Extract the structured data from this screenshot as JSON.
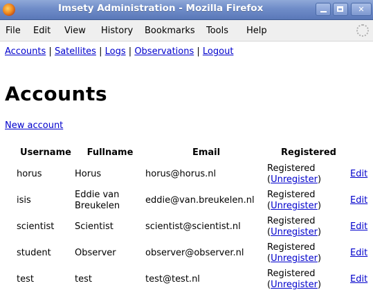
{
  "window": {
    "title": "Imsety Administration - Mozilla Firefox"
  },
  "menubar": {
    "items": [
      "File",
      "Edit",
      "View",
      "History",
      "Bookmarks",
      "Tools",
      "Help"
    ]
  },
  "nav": {
    "links": [
      "Accounts",
      "Satellites",
      "Logs",
      "Observations",
      "Logout"
    ],
    "separator": "|"
  },
  "page": {
    "title": "Accounts",
    "new_account_label": "New account"
  },
  "table": {
    "headers": {
      "username": "Username",
      "fullname": "Fullname",
      "email": "Email",
      "registered": "Registered"
    },
    "rows": [
      {
        "username": "horus",
        "fullname": "Horus",
        "email": "horus@horus.nl",
        "status": "Registered",
        "action": "Unregister",
        "edit": "Edit"
      },
      {
        "username": "isis",
        "fullname": "Eddie van Breukelen",
        "email": "eddie@van.breukelen.nl",
        "status": "Registered",
        "action": "Unregister",
        "edit": "Edit"
      },
      {
        "username": "scientist",
        "fullname": "Scientist",
        "email": "scientist@scientist.nl",
        "status": "Registered",
        "action": "Unregister",
        "edit": "Edit"
      },
      {
        "username": "student",
        "fullname": "Observer",
        "email": "observer@observer.nl",
        "status": "Registered",
        "action": "Unregister",
        "edit": "Edit"
      },
      {
        "username": "test",
        "fullname": "test",
        "email": "test@test.nl",
        "status": "Registered",
        "action": "Unregister",
        "edit": "Edit"
      }
    ],
    "paren_open": "(",
    "paren_close": ")"
  },
  "colors": {
    "link": "#0000cc",
    "titlebar": "#6f8cc8",
    "menubar_bg": "#efefef"
  },
  "icons": {
    "app_logo": "firefox-logo-icon",
    "throbber": "throbber-icon",
    "minimize": "minimize-icon",
    "maximize": "maximize-icon",
    "close": "close-icon"
  }
}
